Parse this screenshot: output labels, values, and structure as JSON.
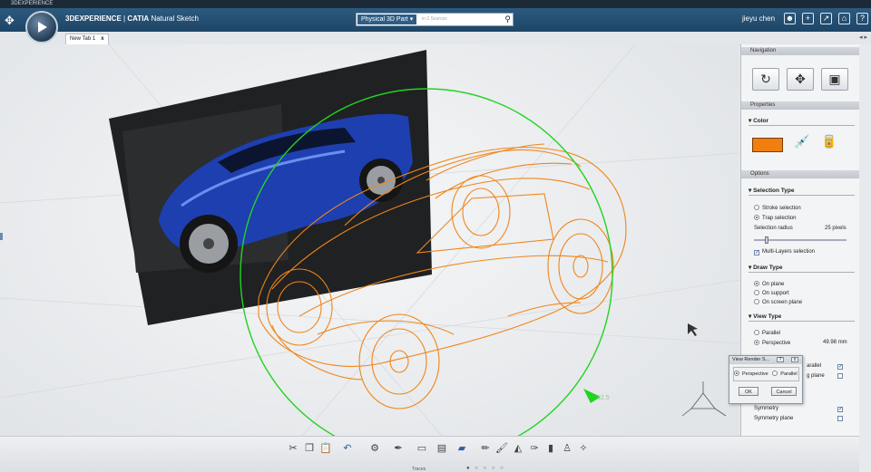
{
  "window": {
    "title": "3DEXPERIENCE"
  },
  "appbar": {
    "brand": "3DEXPERIENCE",
    "separator": "|",
    "product": "CATIA",
    "app_name": "Natural Sketch",
    "search_scope": "Physical 3D Part",
    "search_placeholder": "in 2 Sources",
    "user": "jieyu chen",
    "icons": [
      "user-icon",
      "add-icon",
      "share-icon",
      "home-icon",
      "help-icon"
    ]
  },
  "tabs": [
    {
      "label": "New Tab 1",
      "close": "x"
    }
  ],
  "viewport": {
    "compass_label": "12.5",
    "colors": {
      "sketch": "#f0861a",
      "manipulator": "#22d322",
      "car_body": "#1d3fb0"
    }
  },
  "panel": {
    "navigation": {
      "header": "Navigation",
      "buttons": [
        "rotate-icon",
        "pan-icon",
        "fit-all-icon"
      ]
    },
    "properties": {
      "header": "Properties",
      "color_label": "Color",
      "color_value": "#f07f10"
    },
    "options": {
      "header": "Options",
      "selection_type": {
        "label": "Selection Type",
        "options": [
          "Stroke selection",
          "Trap selection"
        ],
        "selected": "Trap selection",
        "radius_label": "Selection radius",
        "radius_value": "25",
        "radius_unit": "pixels",
        "multi_layers_label": "Multi-Layers selection",
        "multi_layers_checked": true
      },
      "draw_type": {
        "label": "Draw Type",
        "options": [
          "On plane",
          "On support",
          "On screen plane"
        ],
        "selected": "On plane"
      },
      "view_type": {
        "label": "View Type",
        "options": [
          "Parallel",
          "Perspective"
        ],
        "selected": "Perspective",
        "focal_value": "49.98",
        "focal_unit": "mm",
        "partial_row_1": "arallel",
        "partial_row_2": "g plane"
      },
      "symmetry": {
        "label": "Symmetry",
        "checked": true
      },
      "symmetry_plane": {
        "label": "Symmetry plane",
        "checked": false
      }
    }
  },
  "dialog": {
    "title": "View Render S...",
    "help": "?",
    "close": "x",
    "options": [
      "Perspective",
      "Parallel"
    ],
    "selected": "Perspective",
    "ok": "OK",
    "cancel": "Cancel"
  },
  "actionbar": {
    "section_label": "Traces",
    "icons": [
      "scissors-icon",
      "copy-icon",
      "paste-icon",
      "undo-icon",
      "settings-icon",
      "pen-icon",
      "eraser-icon",
      "layers-icon",
      "blue-marker-icon",
      "pencil-icon",
      "brush-icon",
      "lamp-icon",
      "pen-tool-icon",
      "marker-icon",
      "person-icon",
      "wand-icon"
    ]
  }
}
